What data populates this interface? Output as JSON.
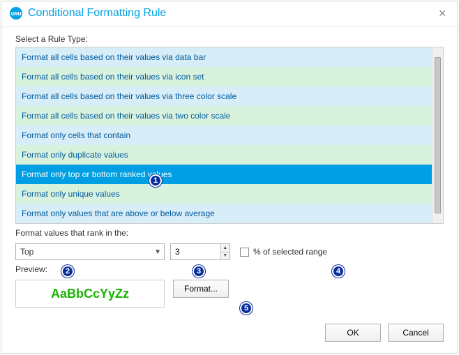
{
  "dialog": {
    "app_icon_text": "usu",
    "title": "Conditional Formatting Rule"
  },
  "rule_type": {
    "label": "Select a Rule Type:",
    "options": [
      "Format all cells based on their values via data bar",
      "Format all cells based on their values via icon set",
      "Format all cells based on their values via three color scale",
      "Format all cells based on their values via two color scale",
      "Format only cells that contain",
      "Format only duplicate values",
      "Format only top or bottom ranked values",
      "Format only unique values",
      "Format only values that are above or below average"
    ],
    "selected_index": 6
  },
  "rank": {
    "label": "Format values that rank in the:",
    "direction": "Top",
    "count": "3",
    "percent_label": "% of selected range",
    "percent_checked": false
  },
  "preview": {
    "label": "Preview:",
    "sample_text": "AaBbCcYyZz",
    "sample_color": "#18b300",
    "format_button": "Format..."
  },
  "buttons": {
    "ok": "OK",
    "cancel": "Cancel"
  },
  "callouts": [
    "1",
    "2",
    "3",
    "4",
    "5"
  ]
}
